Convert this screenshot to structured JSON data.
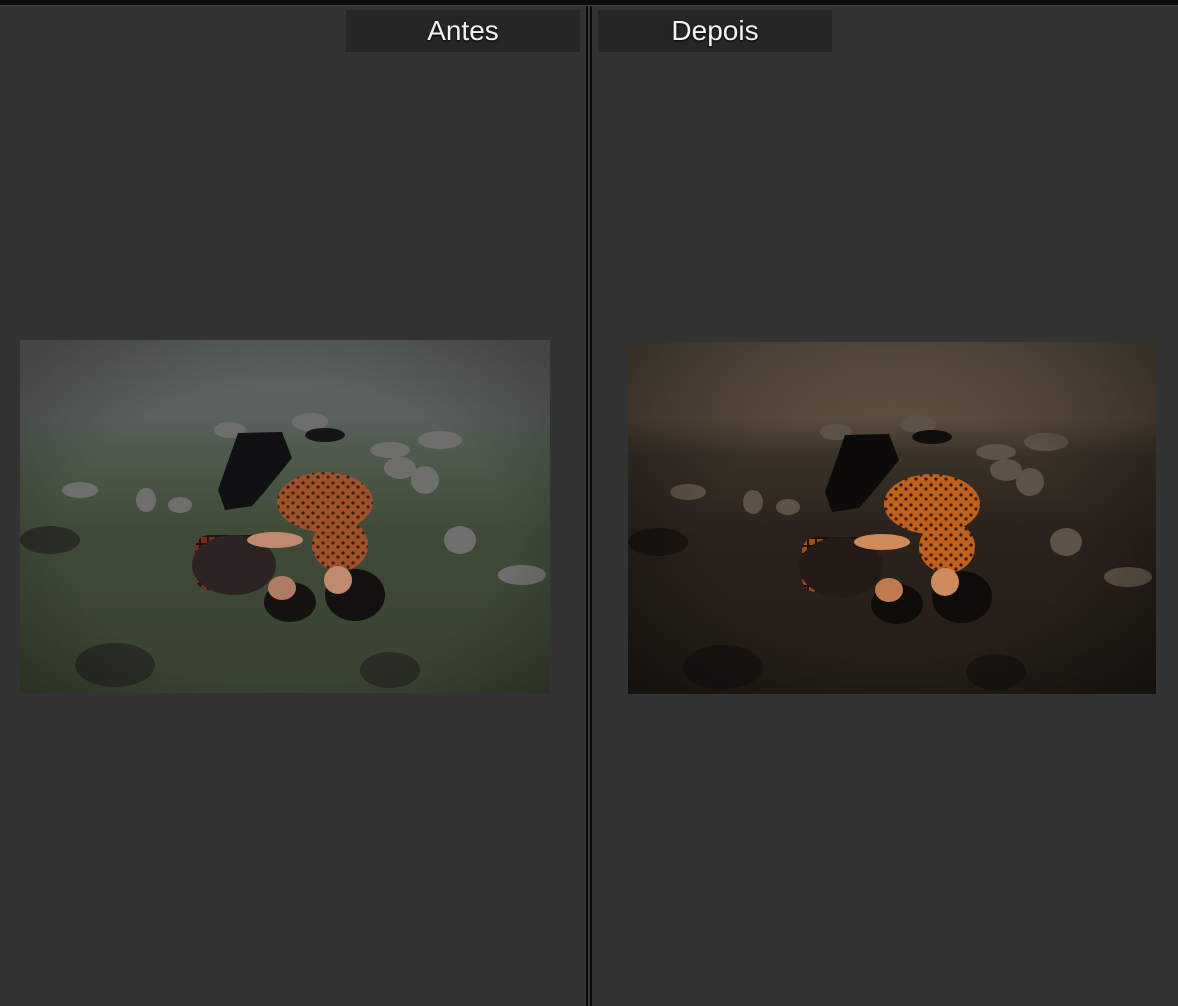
{
  "panels": {
    "before": {
      "label": "Antes"
    },
    "after": {
      "label": "Depois"
    }
  },
  "colors": {
    "background": "#333333",
    "label_background": "#262626",
    "label_text": "#f4f4f4",
    "divider": "#080808"
  }
}
